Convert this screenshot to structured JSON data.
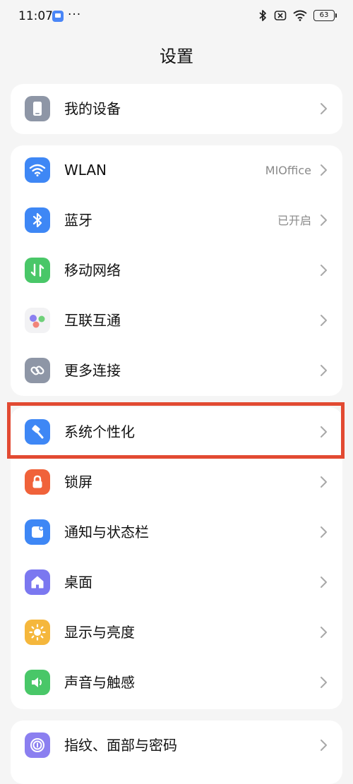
{
  "status": {
    "time": "11:07",
    "more": "···",
    "battery": "63"
  },
  "page": {
    "title": "设置"
  },
  "groups": [
    {
      "items": [
        {
          "label": "我的设备",
          "value": "",
          "icon": "phone-icon",
          "color": "#8e96a6"
        }
      ]
    },
    {
      "items": [
        {
          "label": "WLAN",
          "value": "MIOffice",
          "icon": "wifi-icon",
          "color": "#3e87f5"
        },
        {
          "label": "蓝牙",
          "value": "已开启",
          "icon": "bluetooth-icon",
          "color": "#3e87f5"
        },
        {
          "label": "移动网络",
          "value": "",
          "icon": "mobile-data-icon",
          "color": "#49c768"
        },
        {
          "label": "互联互通",
          "value": "",
          "icon": "interconnect-icon",
          "color": "#f2f2f4"
        },
        {
          "label": "更多连接",
          "value": "",
          "icon": "link-icon",
          "color": "#8e96a6"
        }
      ]
    },
    {
      "items": [
        {
          "label": "系统个性化",
          "value": "",
          "icon": "theme-brush-icon",
          "color": "#3e87f5"
        },
        {
          "label": "锁屏",
          "value": "",
          "icon": "lock-icon",
          "color": "#f0623a"
        },
        {
          "label": "通知与状态栏",
          "value": "",
          "icon": "notification-icon",
          "color": "#3e87f5"
        },
        {
          "label": "桌面",
          "value": "",
          "icon": "home-icon",
          "color": "#7b78f0"
        },
        {
          "label": "显示与亮度",
          "value": "",
          "icon": "sun-icon",
          "color": "#f5b73c"
        },
        {
          "label": "声音与触感",
          "value": "",
          "icon": "speaker-icon",
          "color": "#49c768"
        }
      ]
    },
    {
      "items": [
        {
          "label": "指纹、面部与密码",
          "value": "",
          "icon": "fingerprint-icon",
          "color": "#8b7ff0"
        }
      ]
    }
  ],
  "colors": {
    "highlight": "#e24a32",
    "background": "#f5f5f5",
    "chevron": "#a8a8a8"
  }
}
